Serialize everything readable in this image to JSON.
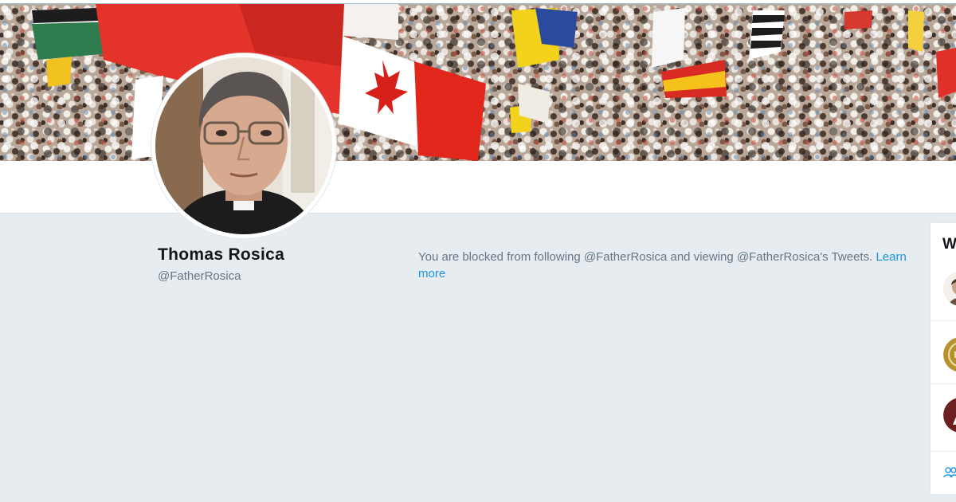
{
  "profile": {
    "name": "Thomas Rosica",
    "handle": "@FatherRosica"
  },
  "notice": {
    "message": "You are blocked from following @FatherRosica and viewing @FatherRosica's Tweets.",
    "link_label": "Learn more"
  },
  "sidebar": {
    "title_visible": "W",
    "suggestions": [
      {
        "avatar": "user-avatar-1"
      },
      {
        "avatar": "user-avatar-2"
      },
      {
        "avatar": "user-avatar-3"
      }
    ],
    "footer_icon": "people-icon"
  },
  "colors": {
    "link": "#1b95e0",
    "background": "#e6ecf0",
    "text_secondary": "#657786",
    "text_primary": "#14171a"
  }
}
